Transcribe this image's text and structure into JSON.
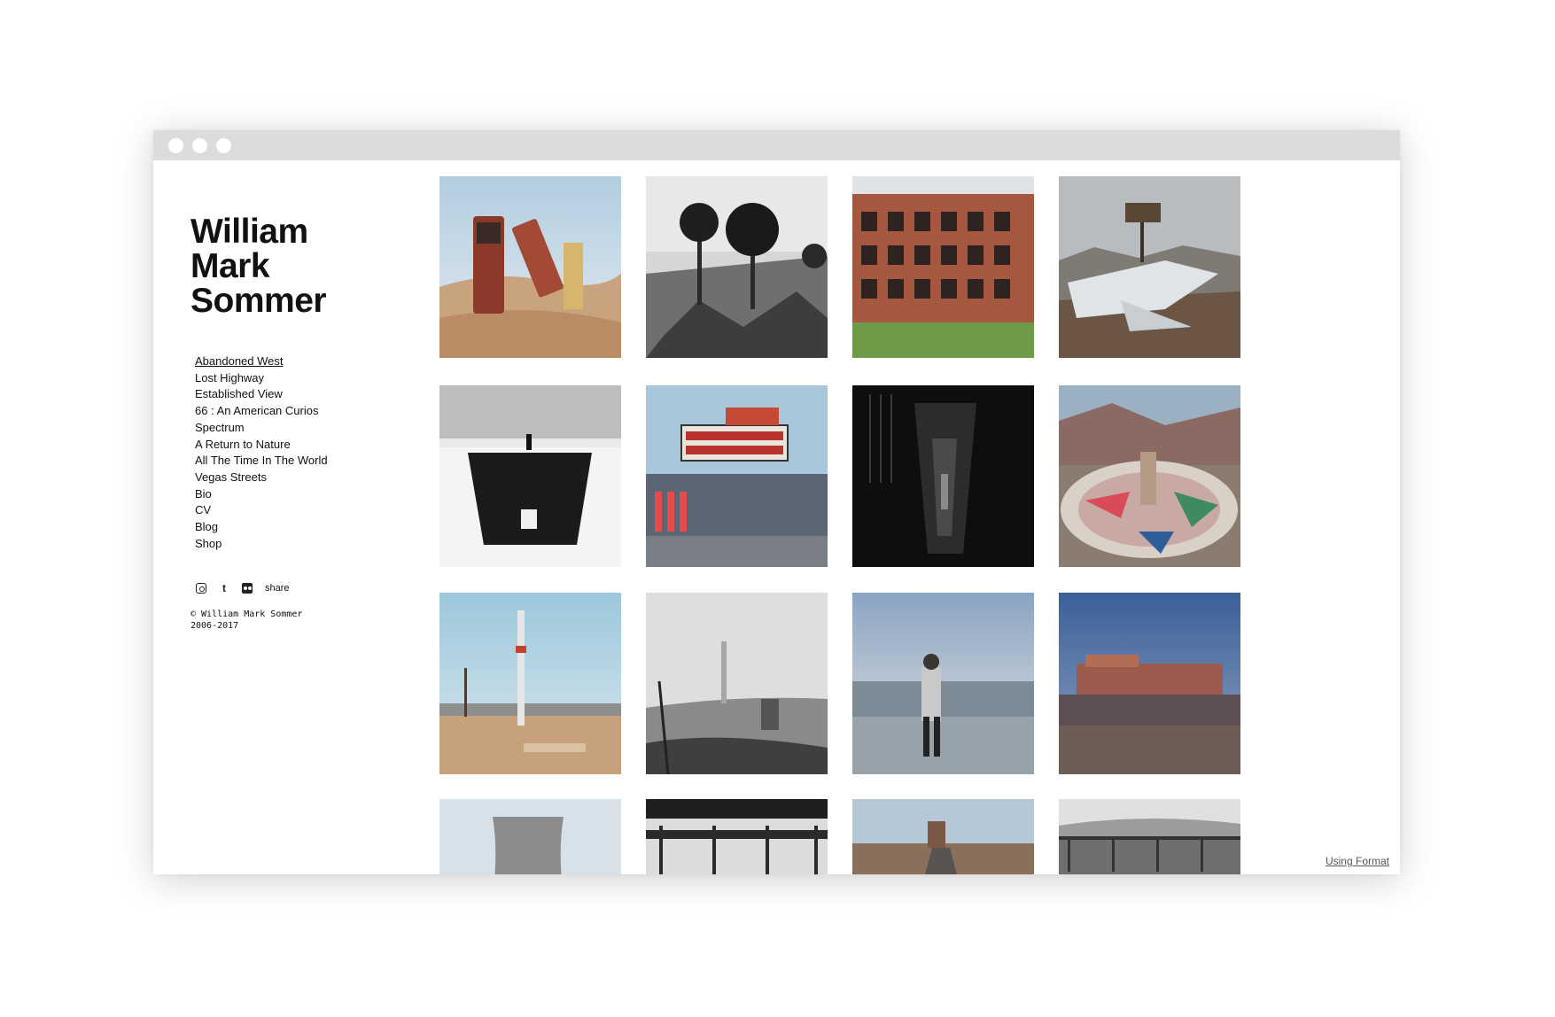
{
  "site": {
    "title_lines": [
      "William",
      "Mark",
      "Sommer"
    ]
  },
  "nav": {
    "items": [
      {
        "label": "Abandoned West",
        "active": true
      },
      {
        "label": "Lost Highway"
      },
      {
        "label": "Established View"
      },
      {
        "label": "66 : An American Curios"
      },
      {
        "label": "Spectrum"
      },
      {
        "label": "A Return to Nature"
      },
      {
        "label": "All The Time In The World"
      },
      {
        "label": "Vegas Streets"
      },
      {
        "label": "Bio"
      },
      {
        "label": "CV"
      },
      {
        "label": "Blog"
      },
      {
        "label": "Shop"
      }
    ]
  },
  "social": {
    "icons": [
      "instagram-icon",
      "tumblr-icon",
      "flickr-icon"
    ],
    "share_label": "share"
  },
  "footer": {
    "copyright_line1": "© William Mark Sommer",
    "copyright_line2": "2006-2017",
    "using_format_label": "Using Format"
  },
  "gallery": {
    "photos": [
      {
        "subject": "stacked-cars-desert",
        "palette": [
          "#b9cfdd",
          "#c49a74"
        ]
      },
      {
        "subject": "palm-trees-bw",
        "palette": [
          "#cfcfcf",
          "#333333"
        ]
      },
      {
        "subject": "abandoned-hotel",
        "palette": [
          "#d9dde0",
          "#a0533e"
        ]
      },
      {
        "subject": "crashed-plane",
        "palette": [
          "#b8bcbf",
          "#6e5a4c"
        ]
      },
      {
        "subject": "snow-tunnel-bw",
        "palette": [
          "#e8e8e8",
          "#222222"
        ]
      },
      {
        "subject": "theatre-marquee",
        "palette": [
          "#a9c6db",
          "#5c6a7a"
        ]
      },
      {
        "subject": "dark-corridor-bw",
        "palette": [
          "#111111",
          "#555555"
        ]
      },
      {
        "subject": "painted-ground-circle",
        "palette": [
          "#9aa9b7",
          "#a37a6c"
        ]
      },
      {
        "subject": "tall-sign-post",
        "palette": [
          "#a6ccdd",
          "#c39a74"
        ]
      },
      {
        "subject": "bridge-in-fog-bw",
        "palette": [
          "#dcdcdc",
          "#555555"
        ]
      },
      {
        "subject": "skater-at-dusk",
        "palette": [
          "#8fa6c0",
          "#7d8a93"
        ]
      },
      {
        "subject": "building-at-dusk",
        "palette": [
          "#3d5e92",
          "#6b5a58"
        ]
      },
      {
        "subject": "cooling-tower",
        "palette": [
          "#c7d4de",
          "#8d8d8d"
        ]
      },
      {
        "subject": "metal-structure-bw",
        "palette": [
          "#dddddd",
          "#222222"
        ]
      },
      {
        "subject": "road-to-arch",
        "palette": [
          "#b2c4d3",
          "#8a6f5a"
        ]
      },
      {
        "subject": "fence-landscape-bw",
        "palette": [
          "#d8d8d8",
          "#6a6a6a"
        ]
      }
    ]
  }
}
